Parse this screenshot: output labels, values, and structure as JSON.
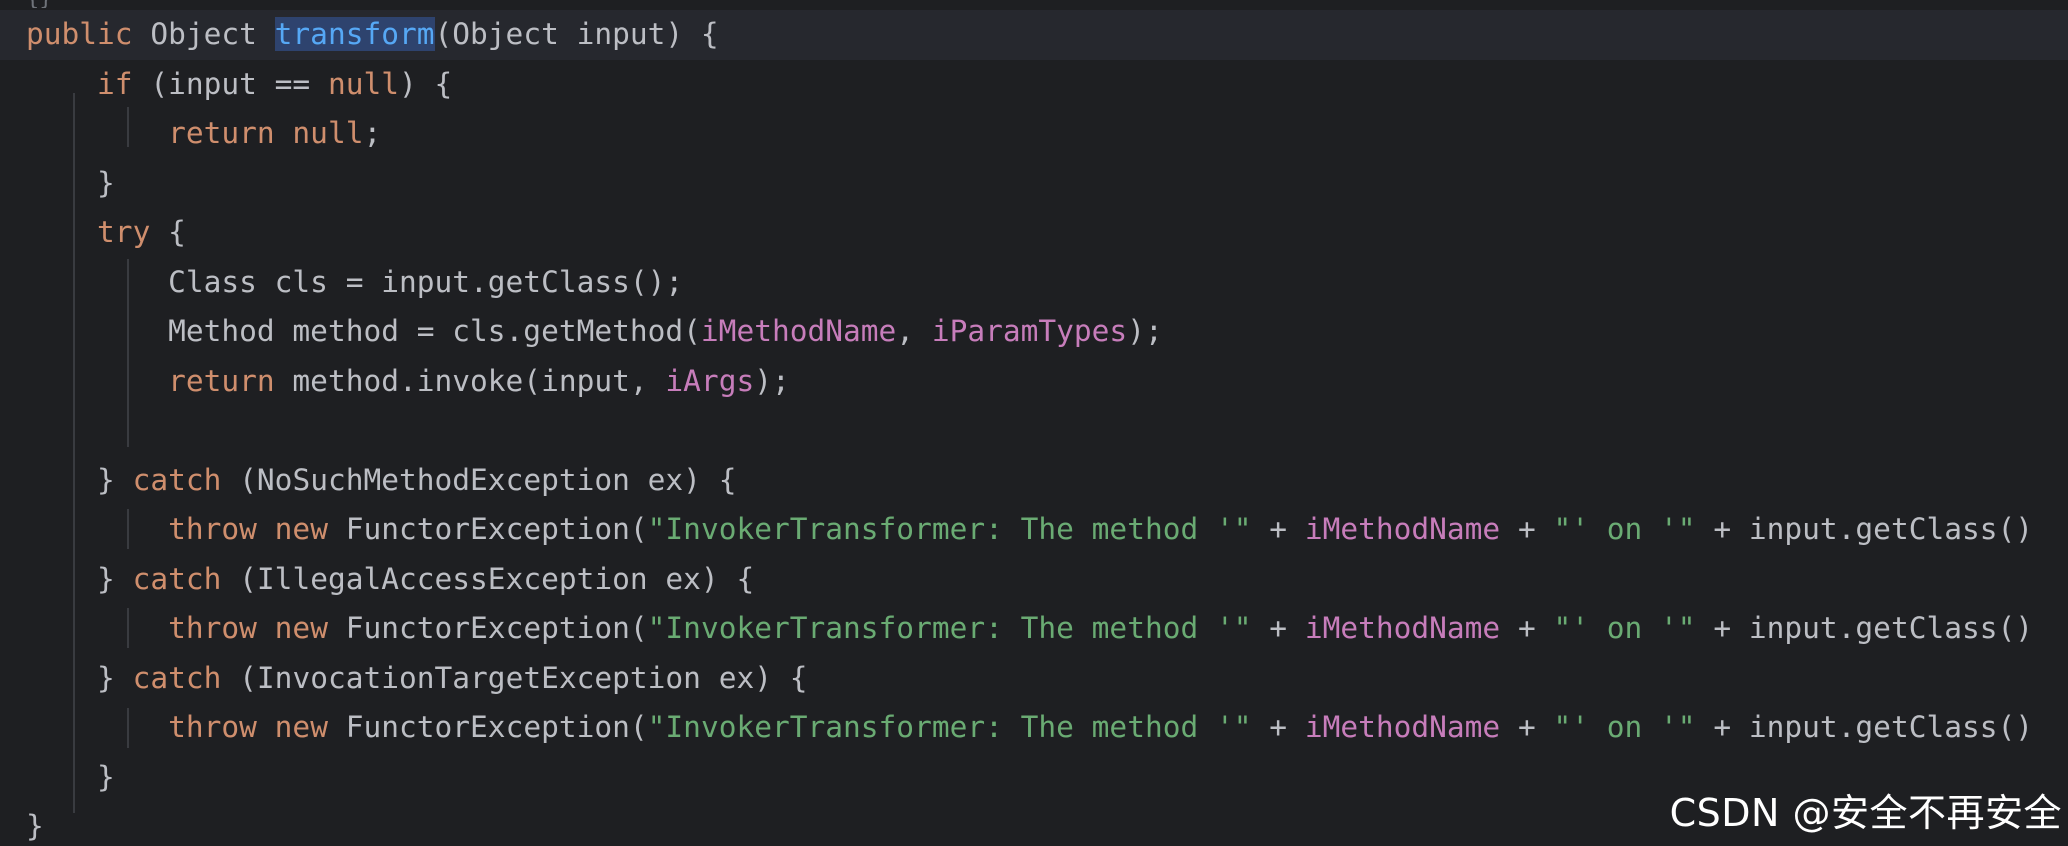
{
  "editor": {
    "top_fold_marker": "{}",
    "lines": [
      {
        "current": true,
        "tokens": [
          {
            "t": "public ",
            "c": "kw"
          },
          {
            "t": "Object ",
            "c": "plain"
          },
          {
            "t": "transform",
            "c": "fn",
            "hl": true
          },
          {
            "t": "(Object input) {",
            "c": "plain"
          }
        ]
      },
      {
        "tokens": [
          {
            "t": "    "
          },
          {
            "t": "if ",
            "c": "kw"
          },
          {
            "t": "(input == ",
            "c": "plain"
          },
          {
            "t": "null",
            "c": "kw"
          },
          {
            "t": ") {",
            "c": "plain"
          }
        ]
      },
      {
        "tokens": [
          {
            "t": "        "
          },
          {
            "t": "return ",
            "c": "kw"
          },
          {
            "t": "null",
            "c": "kw"
          },
          {
            "t": ";",
            "c": "plain"
          }
        ]
      },
      {
        "tokens": [
          {
            "t": "    "
          },
          {
            "t": "}",
            "c": "plain"
          }
        ]
      },
      {
        "tokens": [
          {
            "t": "    "
          },
          {
            "t": "try ",
            "c": "kw"
          },
          {
            "t": "{",
            "c": "plain"
          }
        ]
      },
      {
        "tokens": [
          {
            "t": "        "
          },
          {
            "t": "Class cls = input.getClass();",
            "c": "plain"
          }
        ]
      },
      {
        "tokens": [
          {
            "t": "        "
          },
          {
            "t": "Method method = cls.getMethod(",
            "c": "plain"
          },
          {
            "t": "iMethodName",
            "c": "fld"
          },
          {
            "t": ", ",
            "c": "plain"
          },
          {
            "t": "iParamTypes",
            "c": "fld"
          },
          {
            "t": ");",
            "c": "plain"
          }
        ]
      },
      {
        "tokens": [
          {
            "t": "        "
          },
          {
            "t": "return ",
            "c": "kw"
          },
          {
            "t": "method.invoke(input, ",
            "c": "plain"
          },
          {
            "t": "iArgs",
            "c": "fld"
          },
          {
            "t": ");",
            "c": "plain"
          }
        ]
      },
      {
        "tokens": []
      },
      {
        "tokens": [
          {
            "t": "    "
          },
          {
            "t": "} ",
            "c": "plain"
          },
          {
            "t": "catch ",
            "c": "kw"
          },
          {
            "t": "(NoSuchMethodException ex) {",
            "c": "plain"
          }
        ]
      },
      {
        "tokens": [
          {
            "t": "        "
          },
          {
            "t": "throw ",
            "c": "kw"
          },
          {
            "t": "new ",
            "c": "kw"
          },
          {
            "t": "FunctorException(",
            "c": "plain"
          },
          {
            "t": "\"InvokerTransformer: The method '\"",
            "c": "str"
          },
          {
            "t": " + ",
            "c": "plain"
          },
          {
            "t": "iMethodName",
            "c": "fld"
          },
          {
            "t": " + ",
            "c": "plain"
          },
          {
            "t": "\"' on '\"",
            "c": "str"
          },
          {
            "t": " + input.getClass()",
            "c": "plain"
          }
        ]
      },
      {
        "tokens": [
          {
            "t": "    "
          },
          {
            "t": "} ",
            "c": "plain"
          },
          {
            "t": "catch ",
            "c": "kw"
          },
          {
            "t": "(IllegalAccessException ex) {",
            "c": "plain"
          }
        ]
      },
      {
        "tokens": [
          {
            "t": "        "
          },
          {
            "t": "throw ",
            "c": "kw"
          },
          {
            "t": "new ",
            "c": "kw"
          },
          {
            "t": "FunctorException(",
            "c": "plain"
          },
          {
            "t": "\"InvokerTransformer: The method '\"",
            "c": "str"
          },
          {
            "t": " + ",
            "c": "plain"
          },
          {
            "t": "iMethodName",
            "c": "fld"
          },
          {
            "t": " + ",
            "c": "plain"
          },
          {
            "t": "\"' on '\"",
            "c": "str"
          },
          {
            "t": " + input.getClass()",
            "c": "plain"
          }
        ]
      },
      {
        "tokens": [
          {
            "t": "    "
          },
          {
            "t": "} ",
            "c": "plain"
          },
          {
            "t": "catch ",
            "c": "kw"
          },
          {
            "t": "(InvocationTargetException ex) {",
            "c": "plain"
          }
        ]
      },
      {
        "tokens": [
          {
            "t": "        "
          },
          {
            "t": "throw ",
            "c": "kw"
          },
          {
            "t": "new ",
            "c": "kw"
          },
          {
            "t": "FunctorException(",
            "c": "plain"
          },
          {
            "t": "\"InvokerTransformer: The method '\"",
            "c": "str"
          },
          {
            "t": " + ",
            "c": "plain"
          },
          {
            "t": "iMethodName",
            "c": "fld"
          },
          {
            "t": " + ",
            "c": "plain"
          },
          {
            "t": "\"' on '\"",
            "c": "str"
          },
          {
            "t": " + input.getClass()",
            "c": "plain"
          }
        ]
      },
      {
        "tokens": [
          {
            "t": "    "
          },
          {
            "t": "}",
            "c": "plain"
          }
        ]
      },
      {
        "tokens": [
          {
            "t": "}",
            "c": "plain"
          }
        ]
      }
    ]
  },
  "watermark": {
    "text": "CSDN @安全不再安全"
  },
  "colors": {
    "background": "#1e1f22",
    "current_line": "#26282e",
    "keyword": "#cf8e6d",
    "method_declaration": "#56a8f5",
    "field": "#c77dbb",
    "string": "#6aab73",
    "plain": "#bcbec4",
    "identifier_highlight": "#2e436e"
  }
}
